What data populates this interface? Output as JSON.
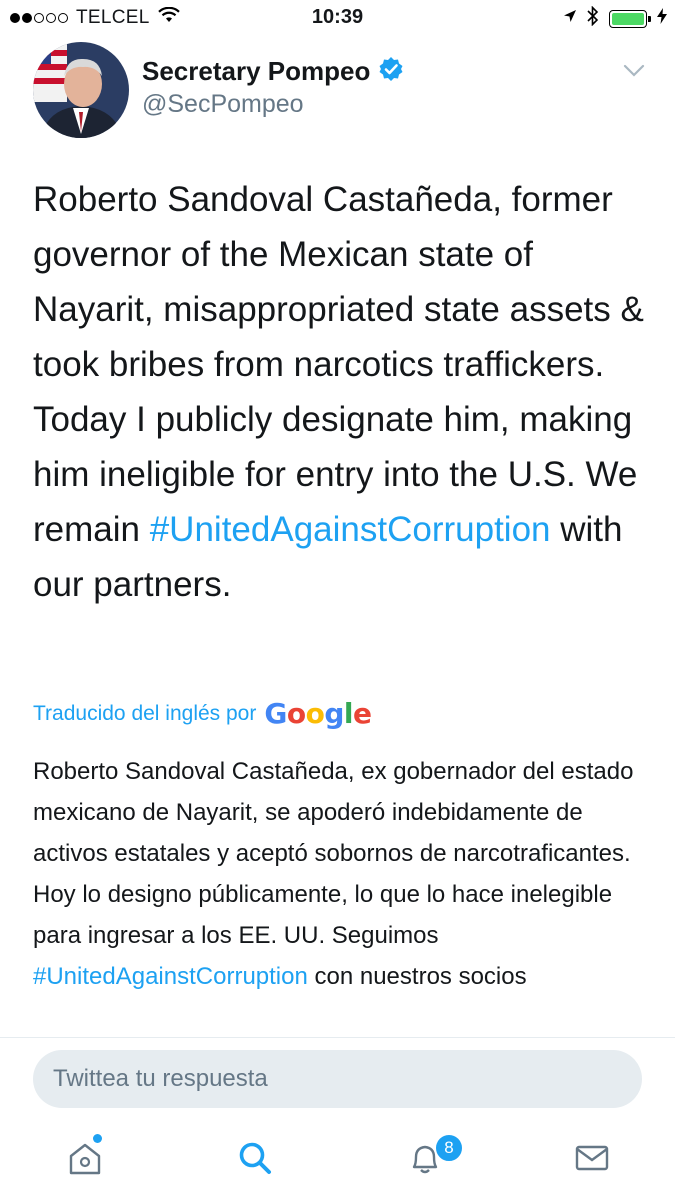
{
  "status_bar": {
    "carrier": "TELCEL",
    "time": "10:39",
    "signal_bars_filled": 2,
    "signal_bars_total": 5,
    "battery_level": 1.0
  },
  "tweet": {
    "display_name": "Secretary Pompeo",
    "handle": "@SecPompeo",
    "verified": true,
    "text_before": "Roberto Sandoval Castañeda, former governor of the Mexican state of Nayarit, misappropriated state assets & took bribes from narcotics traffickers. Today I publicly designate him, making him ineligible for entry into the U.S. We remain ",
    "hashtag": "#UnitedAgainstCorruption",
    "text_after": " with our partners.",
    "translated_label": "Traducido del inglés por",
    "translation_before": "Roberto Sandoval Castañeda, ex gobernador del estado mexicano de Nayarit, se apoderó indebidamente de activos estatales y aceptó sobornos de narcotraficantes. Hoy lo designo públicamente, lo que lo hace inelegible para ingresar a los EE. UU. Seguimos ",
    "translation_hashtag": "#UnitedAgainstCorruption",
    "translation_after": " con nuestros socios"
  },
  "reply": {
    "placeholder": "Twittea tu respuesta"
  },
  "tab_bar": {
    "notifications_badge": "8"
  },
  "colors": {
    "twitter_blue": "#1da1f2",
    "text_primary": "#14171a",
    "text_secondary": "#657786",
    "input_bg": "#e6ecf0",
    "battery_green": "#4cd964"
  },
  "icons": {
    "status": [
      "location-arrow-icon",
      "bluetooth-icon",
      "battery-icon",
      "charging-icon",
      "wifi-icon"
    ],
    "header": [
      "verified-badge-icon",
      "chevron-down-icon"
    ],
    "tabs": [
      "home-icon",
      "search-icon",
      "notifications-bell-icon",
      "messages-envelope-icon"
    ]
  }
}
